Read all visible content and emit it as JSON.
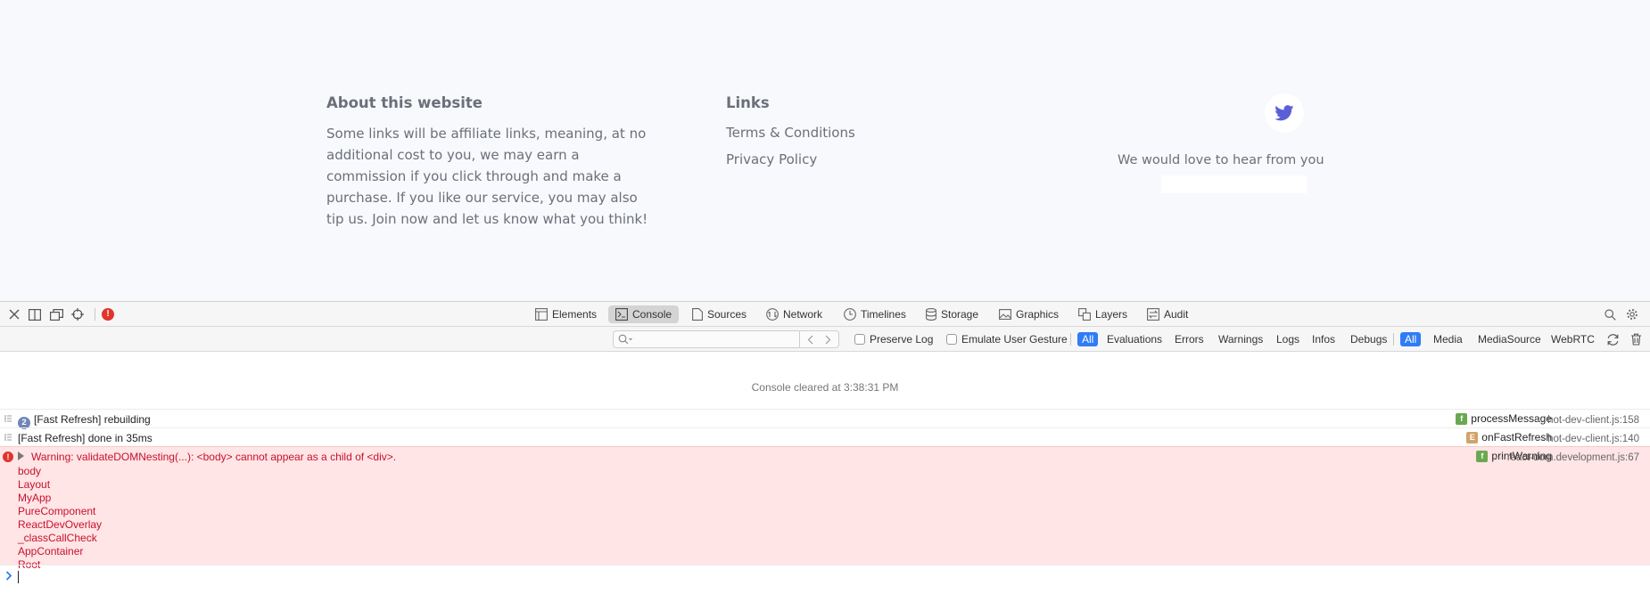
{
  "footer": {
    "about_title": "About this website",
    "about_text": "Some links will be affiliate links, meaning, at no additional cost to you, we may earn a commission if you click through and make a purchase. If you like our service, you may also tip us. Join now and let us know what you think!",
    "links_title": "Links",
    "links": [
      "Terms & Conditions",
      "Privacy Policy"
    ],
    "contact_text": "We would love to hear from you",
    "twitter_icon": "twitter-bird-icon",
    "twitter_color": "#5b5fd6"
  },
  "inspector": {
    "error_badge": "!",
    "tabs": [
      {
        "label": "Elements",
        "icon": "elements-icon"
      },
      {
        "label": "Console",
        "icon": "console-icon"
      },
      {
        "label": "Sources",
        "icon": "sources-icon"
      },
      {
        "label": "Network",
        "icon": "network-icon"
      },
      {
        "label": "Timelines",
        "icon": "timelines-icon"
      },
      {
        "label": "Storage",
        "icon": "storage-icon"
      },
      {
        "label": "Graphics",
        "icon": "graphics-icon"
      },
      {
        "label": "Layers",
        "icon": "layers-icon"
      },
      {
        "label": "Audit",
        "icon": "audit-icon"
      }
    ],
    "active_tab": "Console",
    "filter": {
      "search_placeholder": "",
      "preserve_log": "Preserve Log",
      "emulate_gesture": "Emulate User Gesture",
      "level_buttons": [
        "All",
        "Evaluations",
        "Errors",
        "Warnings",
        "Logs",
        "Infos",
        "Debugs"
      ],
      "source_buttons": [
        "All",
        "Media",
        "MediaSource",
        "WebRTC"
      ]
    },
    "accent_color": "#2f7cf6"
  },
  "console": {
    "cleared": "Console cleared at 3:38:31 PM",
    "messages": [
      {
        "count": "2",
        "text": "[Fast Refresh] rebuilding",
        "func": "processMessage",
        "func_badge": "f",
        "location": "hot-dev-client.js:158"
      },
      {
        "text": "[Fast Refresh] done in 35ms",
        "func": "onFastRefresh",
        "func_badge": "E",
        "location": "hot-dev-client.js:140"
      }
    ],
    "error": {
      "text": "Warning: validateDOMNesting(...): <body> cannot appear as a child of <div>.",
      "func": "printWarning",
      "func_badge": "f",
      "location": "react-dom.development.js:67",
      "stack": [
        "body",
        "Layout",
        "MyApp",
        "PureComponent",
        "ReactDevOverlay",
        "_classCallCheck",
        "AppContainer",
        "Root"
      ]
    }
  }
}
